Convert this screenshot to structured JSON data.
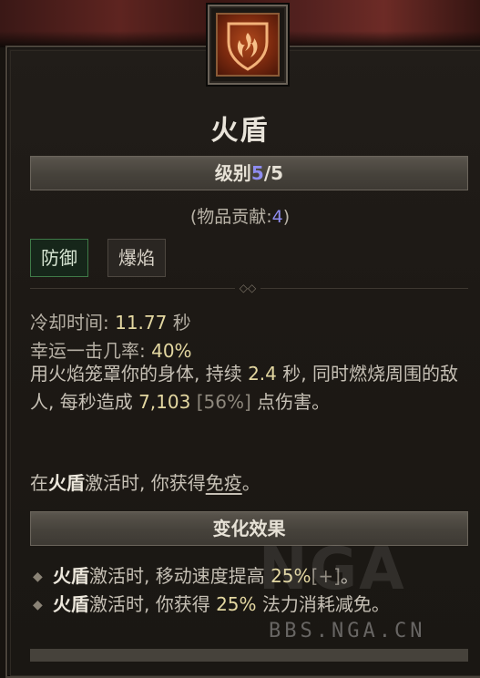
{
  "skill": {
    "name": "火盾",
    "rank_label": "级别",
    "rank_current": "5",
    "rank_max": "/5",
    "contribution_prefix": "(物品贡献:",
    "contribution_value": "4",
    "contribution_suffix": ")",
    "icon": "fire-shield-icon"
  },
  "tags": [
    "防御",
    "爆焰"
  ],
  "stats": {
    "cooldown_label": "冷却时间: ",
    "cooldown_value": "11.77",
    "cooldown_unit": " 秒",
    "lucky_label": "幸运一击几率: ",
    "lucky_value": "40%"
  },
  "description": {
    "p1_a": "用火焰笼罩你的身体, 持续 ",
    "p1_duration": "2.4",
    "p1_b": " 秒, 同时燃烧周围的敌人, 每秒造成 ",
    "p1_damage": "7,103",
    "p1_bracket": " [56%]",
    "p1_c": " 点伤害。",
    "p2_prefix": "在",
    "p2_skill": "火盾",
    "p2_mid": "激活时, 你获得",
    "p2_keyword": "免疫",
    "p2_suffix": "。"
  },
  "modifiers": {
    "header": "变化效果",
    "items": [
      {
        "skill": "火盾",
        "text_a": "激活时, 移动速度提高 ",
        "value": "25%",
        "bracket": "[+]",
        "text_b": "。"
      },
      {
        "skill": "火盾",
        "text_a": "激活时, 你获得 ",
        "value": "25%",
        "bracket": "",
        "text_b": " 法力消耗减免。"
      }
    ]
  },
  "watermark": {
    "logo": "NGA",
    "site": "BBS.NGA.CN"
  },
  "colors": {
    "rank_accent": "#8e8cf0",
    "value_accent": "#e3d7a1",
    "defense_tag_border": "#3f7a48"
  }
}
